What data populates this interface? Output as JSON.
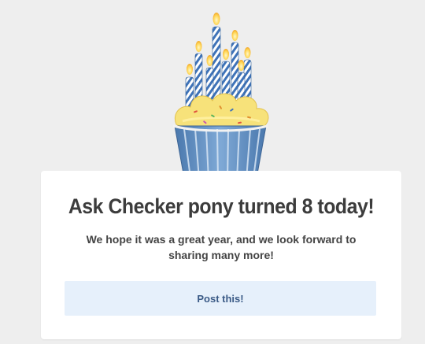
{
  "icon": {
    "name": "birthday-cupcake-icon",
    "candles": 8
  },
  "card": {
    "title": "Ask Checker pony turned 8 today!",
    "message": "We hope it was a great year, and we look forward to sharing many more!",
    "button_label": "Post this!"
  },
  "colors": {
    "background": "#eeeeee",
    "card": "#ffffff",
    "button_bg": "#e6f0fb",
    "button_text": "#3a5a86",
    "title_text": "#3c3c3c",
    "candle_blue": "#3f73b8",
    "frosting": "#f7e27a",
    "wrapper": "#5f8fc4"
  }
}
